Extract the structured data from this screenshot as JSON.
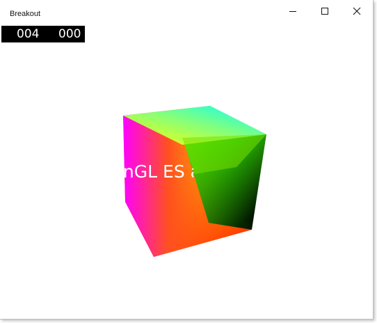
{
  "window": {
    "title": "Breakout"
  },
  "score": {
    "left": "004",
    "right": "000"
  },
  "scene": {
    "overlay_text": "OpenGL ES and XAML",
    "cube_colors": {
      "top_left": "#ffff00",
      "top_back": "#00ffff",
      "right_top": "#00ff00",
      "bottom_right": "#000000",
      "bottom_front": "#ff0000",
      "left_side": "#ff00ff",
      "front_mid": "#ff8800"
    }
  },
  "icons": {
    "minimize": "minimize-icon",
    "maximize": "maximize-icon",
    "close": "close-icon"
  }
}
